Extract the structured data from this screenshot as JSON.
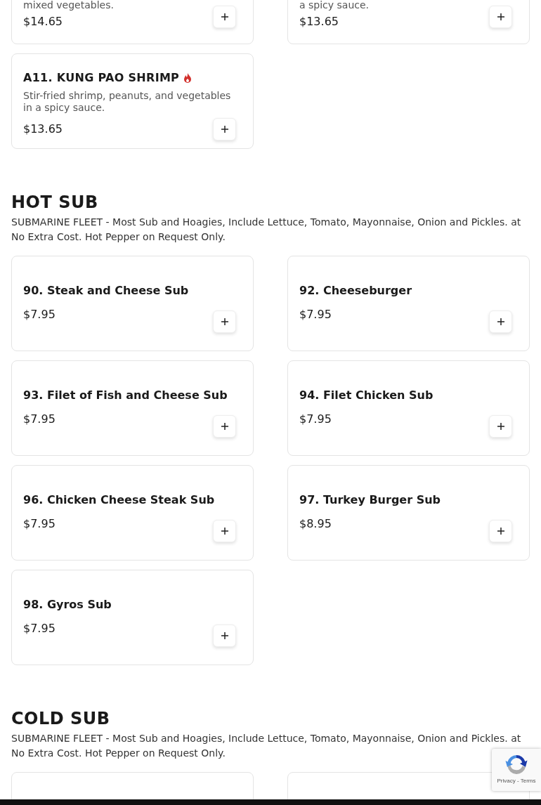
{
  "top_items": [
    {
      "description": "mixed vegetables.",
      "price": "$14.65",
      "spicy": false
    },
    {
      "description": "a spicy sauce.",
      "price": "$13.65",
      "spicy": false
    },
    {
      "name": "A11. KUNG PAO SHRIMP",
      "description": "Stir-fried shrimp, peanuts, and vegetables in a spicy sauce.",
      "price": "$13.65",
      "spicy": true
    }
  ],
  "sections": [
    {
      "title": "HOT SUB",
      "description": "SUBMARINE FLEET - Most Sub and Hoagies, Include Lettuce, Tomato, Mayonnaise, Onion and Pickles. at No Extra Cost. Hot Pepper on Request Only.",
      "items": [
        {
          "kind": "item",
          "name": "90. Steak and Cheese Sub",
          "price": "$7.95"
        },
        {
          "kind": "item",
          "name": "92. Cheeseburger",
          "price": "$7.95"
        },
        {
          "kind": "item",
          "name": "93. Filet of Fish and Cheese Sub",
          "price": "$7.95"
        },
        {
          "kind": "item",
          "name": "94. Filet Chicken Sub",
          "price": "$7.95"
        },
        {
          "kind": "item",
          "name": "96. Chicken Cheese Steak Sub",
          "price": "$7.95"
        },
        {
          "kind": "item",
          "name": "97. Turkey Burger Sub",
          "price": "$8.95"
        },
        {
          "kind": "item",
          "name": "98. Gyros Sub",
          "price": "$7.95"
        }
      ]
    },
    {
      "title": "COLD SUB",
      "description": "SUBMARINE FLEET - Most Sub and Hoagies, Include Lettuce, Tomato, Mayonnaise, Onion and Pickles. at No Extra Cost. Hot Pepper on Request Only.",
      "items": [
        {
          "kind": "cut"
        },
        {
          "kind": "cut"
        }
      ]
    }
  ],
  "recaptcha": {
    "links": "Privacy - Terms"
  }
}
